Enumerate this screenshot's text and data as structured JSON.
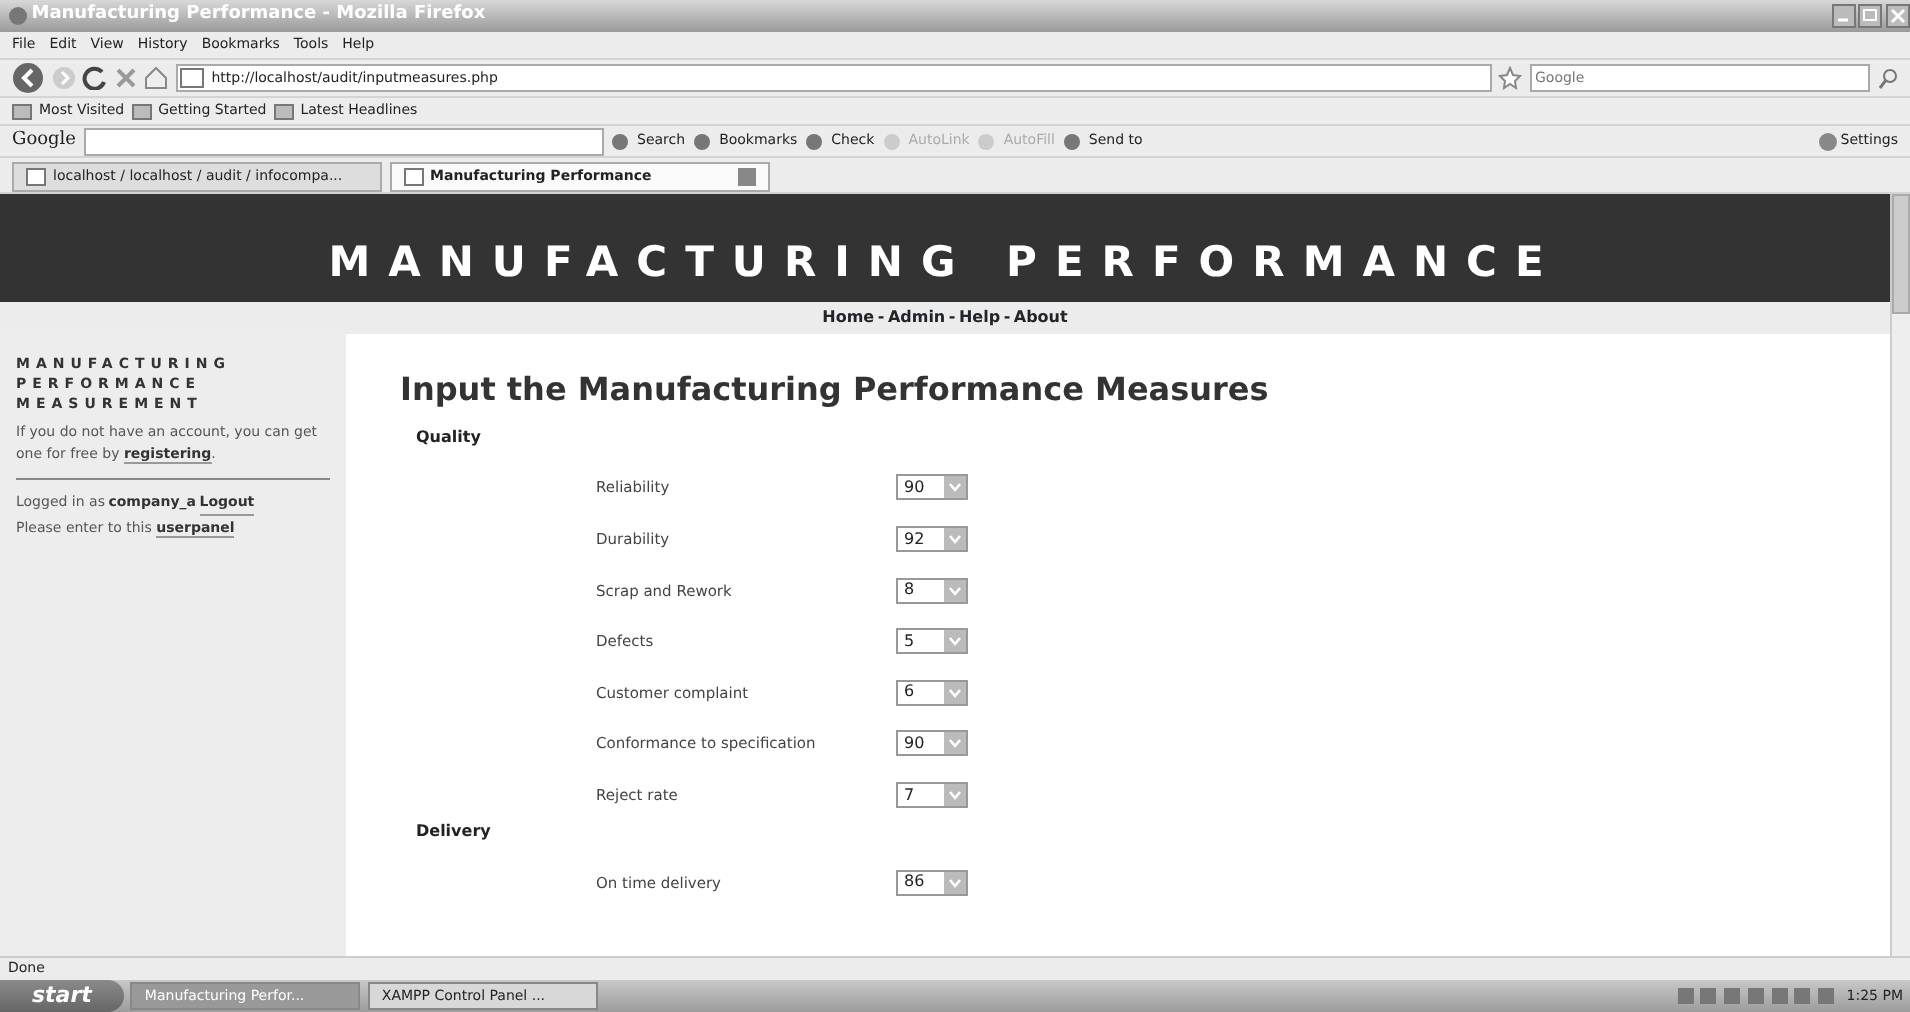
{
  "window": {
    "title": "Manufacturing Performance - Mozilla Firefox"
  },
  "menu": [
    "File",
    "Edit",
    "View",
    "History",
    "Bookmarks",
    "Tools",
    "Help"
  ],
  "address": {
    "url": "http://localhost/audit/inputmeasures.php"
  },
  "search": {
    "placeholder": "Google"
  },
  "bookmarks": [
    "Most Visited",
    "Getting Started",
    "Latest Headlines"
  ],
  "google_toolbar": {
    "brand": "Google",
    "items": [
      {
        "label": "Search",
        "disabled": false
      },
      {
        "label": "Bookmarks",
        "disabled": false
      },
      {
        "label": "Check",
        "disabled": false
      },
      {
        "label": "AutoLink",
        "disabled": true
      },
      {
        "label": "AutoFill",
        "disabled": true
      },
      {
        "label": "Send to",
        "disabled": false
      }
    ],
    "settings": "Settings"
  },
  "tabs": [
    {
      "label": "localhost / localhost / audit / infocompa...",
      "selected": false
    },
    {
      "label": "Manufacturing Performance",
      "selected": true
    }
  ],
  "site": {
    "title": "MANUFACTURING PERFORMANCE",
    "nav": [
      "Home",
      "Admin",
      "Help",
      "About"
    ],
    "separator": "-"
  },
  "sidebar": {
    "heading": "MANUFACTURING PERFORMANCE MEASUREMENT",
    "register": {
      "before": "If you do not have an account, you can get one for free by ",
      "link": "registering",
      "after": "."
    },
    "login": {
      "before": "Logged in as ",
      "user": "company_a",
      "link": "Logout"
    },
    "panel": {
      "before": "Please enter to this ",
      "link": "userpanel"
    }
  },
  "form": {
    "title": "Input the Manufacturing Performance Measures",
    "sections": [
      {
        "title": "Quality",
        "measures": [
          {
            "label": "Reliability",
            "value": "90"
          },
          {
            "label": "Durability",
            "value": "92"
          },
          {
            "label": "Scrap and Rework",
            "value": "8"
          },
          {
            "label": "Defects",
            "value": "5"
          },
          {
            "label": "Customer complaint",
            "value": "6"
          },
          {
            "label": "Conformance to specification",
            "value": "90"
          },
          {
            "label": "Reject rate",
            "value": "7"
          }
        ]
      },
      {
        "title": "Delivery",
        "measures": [
          {
            "label": "On time delivery",
            "value": "86"
          }
        ]
      }
    ]
  },
  "status_bar": "Done",
  "taskbar": {
    "start": "start",
    "tasks": [
      {
        "label": "Manufacturing Perfor...",
        "selected": true
      },
      {
        "label": "XAMPP Control Panel ...",
        "selected": false
      }
    ],
    "clock": "1:25 PM"
  }
}
